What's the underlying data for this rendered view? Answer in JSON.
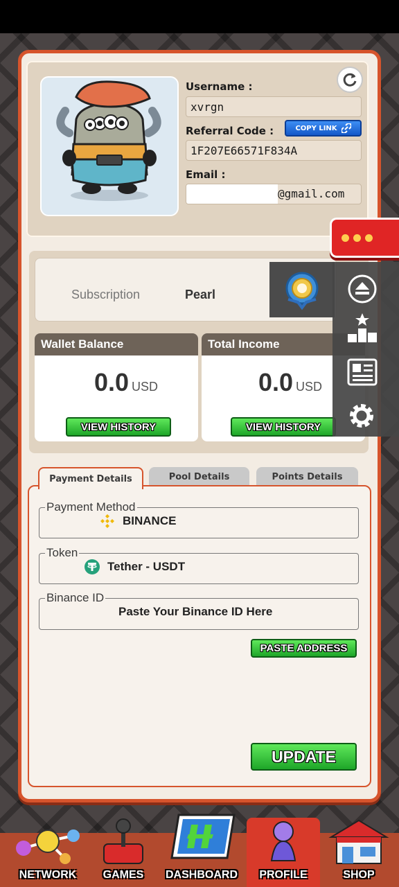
{
  "profile": {
    "username_label": "Username :",
    "username": "xvrgn",
    "referral_label": "Referral Code :",
    "referral_code": "1F207E66571F834A",
    "copy_link_label": "COPY LINK",
    "email_label": "Email :",
    "email_suffix": "@gmail.com"
  },
  "subscription": {
    "label": "Subscription",
    "value": "Pearl"
  },
  "wallet": {
    "title": "Wallet Balance",
    "amount": "0.0",
    "unit": "USD",
    "history_label": "VIEW HISTORY"
  },
  "income": {
    "title": "Total Income",
    "amount": "0.0",
    "unit": "USD",
    "history_label": "VIEW HISTORY"
  },
  "tabs": {
    "payment": "Payment Details",
    "pool": "Pool Details",
    "points": "Points Details"
  },
  "payment": {
    "method_legend": "Payment Method",
    "method_value": "BINANCE",
    "token_legend": "Token",
    "token_value": "Tether - USDT",
    "binance_legend": "Binance ID",
    "binance_placeholder": "Paste Your Binance ID Here",
    "paste_label": "PASTE ADDRESS",
    "update_label": "UPDATE"
  },
  "nav": {
    "network": "NETWORK",
    "games": "GAMES",
    "dashboard": "DASHBOARD",
    "profile": "PROFILE",
    "shop": "SHOP"
  },
  "colors": {
    "accent": "#d6542c",
    "panel_bg": "#f3ece3",
    "green_button": "#1ea629",
    "copy_button": "#1458c8"
  }
}
